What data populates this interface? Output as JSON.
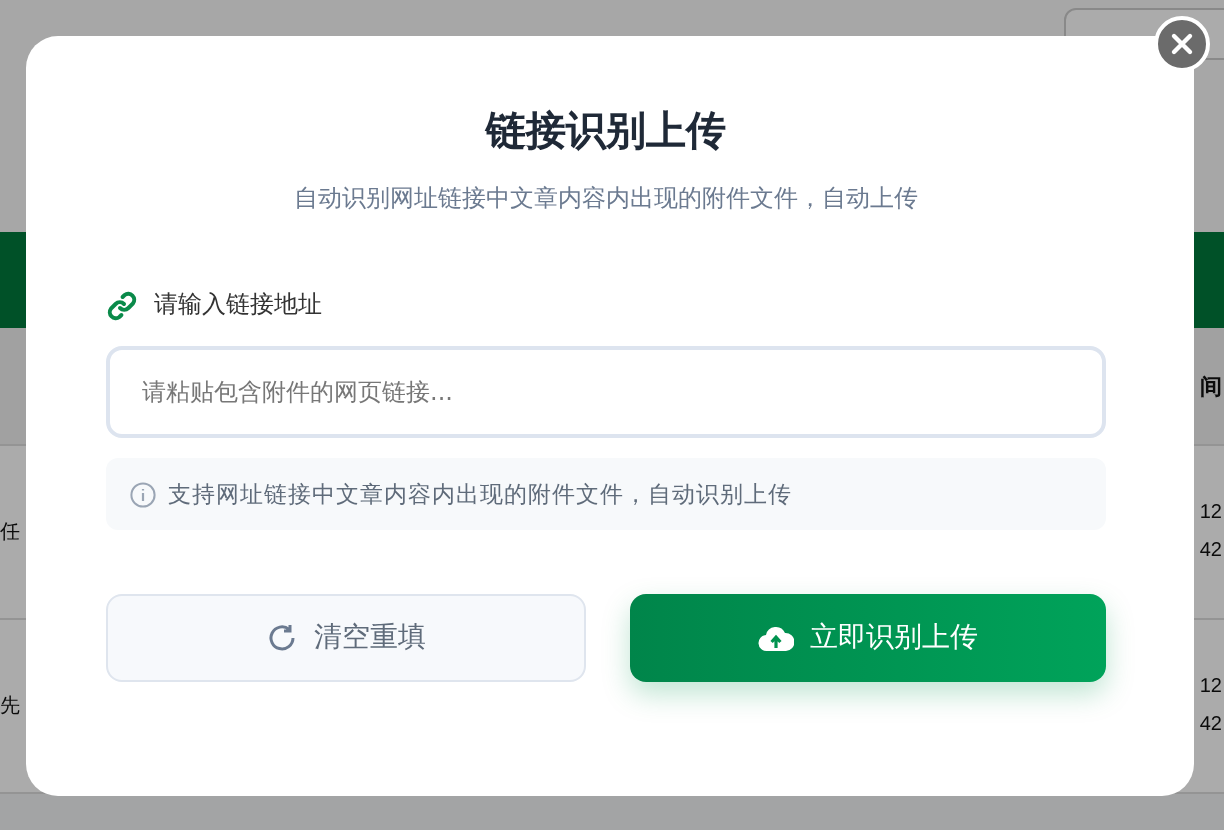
{
  "background": {
    "column_header": "间",
    "rows": [
      {
        "left": "任",
        "date": "12",
        "time": "42"
      },
      {
        "left": "先",
        "date": "12",
        "time": "42"
      }
    ]
  },
  "dialog": {
    "title": "链接识别上传",
    "subtitle": "自动识别网址链接中文章内容内出现的附件文件，自动上传",
    "field_label": "请输入链接地址",
    "url_field": {
      "placeholder": "请粘贴包含附件的网页链接..."
    },
    "hint": "支持网址链接中文章内容内出现的附件文件，自动识别上传",
    "buttons": [
      {
        "kind": "secondary",
        "label": "清空重填"
      },
      {
        "kind": "primary",
        "label": "立即识别上传"
      }
    ]
  }
}
